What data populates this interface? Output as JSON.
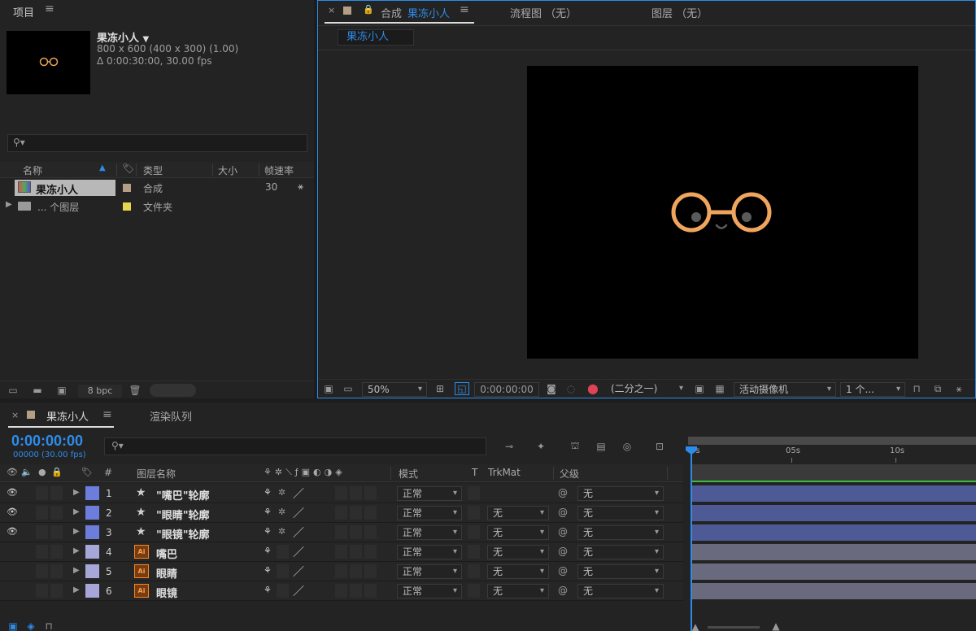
{
  "project": {
    "title": "项目",
    "comp_name": "果冻小人",
    "comp_size": "800 x 600  (400 x 300) (1.00)",
    "comp_duration": "Δ 0:00:30:00, 30.00 fps",
    "columns": {
      "name": "名称",
      "type": "类型",
      "size": "大小",
      "fps": "帧速率"
    },
    "items": [
      {
        "name": "果冻小人",
        "type": "合成",
        "fps": "30",
        "label_color": "#b49f86"
      },
      {
        "name": "... 个图层",
        "type": "文件夹",
        "fps": "",
        "label_color": "#e4d84c"
      }
    ],
    "bpc": "8 bpc"
  },
  "viewer": {
    "tab_prefix": "合成",
    "tab_comp": "果冻小人",
    "tab_flow": "流程图 （无）",
    "tab_layer": "图层 （无）",
    "breadcrumb": "果冻小人",
    "zoom": "50%",
    "timecode": "0:00:00:00",
    "resolution": "(二分之一)",
    "camera": "活动摄像机",
    "views": "1 个..."
  },
  "timeline": {
    "tab_comp": "果冻小人",
    "tab_render": "渲染队列",
    "timecode": "0:00:00:00",
    "frames": "00000 (30.00 fps)",
    "col_layer_name": "图层名称",
    "col_mode": "模式",
    "col_t": "T",
    "col_trkmat": "TrkMat",
    "col_parent": "父级",
    "ruler": [
      "0s",
      "05s",
      "10s"
    ],
    "layers": [
      {
        "num": "1",
        "name": "\"嘴巴\"轮廓",
        "type": "shape",
        "mode": "正常",
        "trkmat": "",
        "parent": "无",
        "label_color": "#6c7ddb",
        "bar_color": "#4e5a96"
      },
      {
        "num": "2",
        "name": "\"眼睛\"轮廓",
        "type": "shape",
        "mode": "正常",
        "trkmat": "无",
        "parent": "无",
        "label_color": "#6c7ddb",
        "bar_color": "#4e5a96"
      },
      {
        "num": "3",
        "name": "\"眼镜\"轮廓",
        "type": "shape",
        "mode": "正常",
        "trkmat": "无",
        "parent": "无",
        "label_color": "#6c7ddb",
        "bar_color": "#4e5a96"
      },
      {
        "num": "4",
        "name": "嘴巴",
        "type": "ai",
        "mode": "正常",
        "trkmat": "无",
        "parent": "无",
        "label_color": "#a6a6d8",
        "bar_color": "#6a6a7e"
      },
      {
        "num": "5",
        "name": "眼睛",
        "type": "ai",
        "mode": "正常",
        "trkmat": "无",
        "parent": "无",
        "label_color": "#a6a6d8",
        "bar_color": "#6a6a7e"
      },
      {
        "num": "6",
        "name": "眼镜",
        "type": "ai",
        "mode": "正常",
        "trkmat": "无",
        "parent": "无",
        "label_color": "#a6a6d8",
        "bar_color": "#6a6a7e"
      }
    ]
  }
}
